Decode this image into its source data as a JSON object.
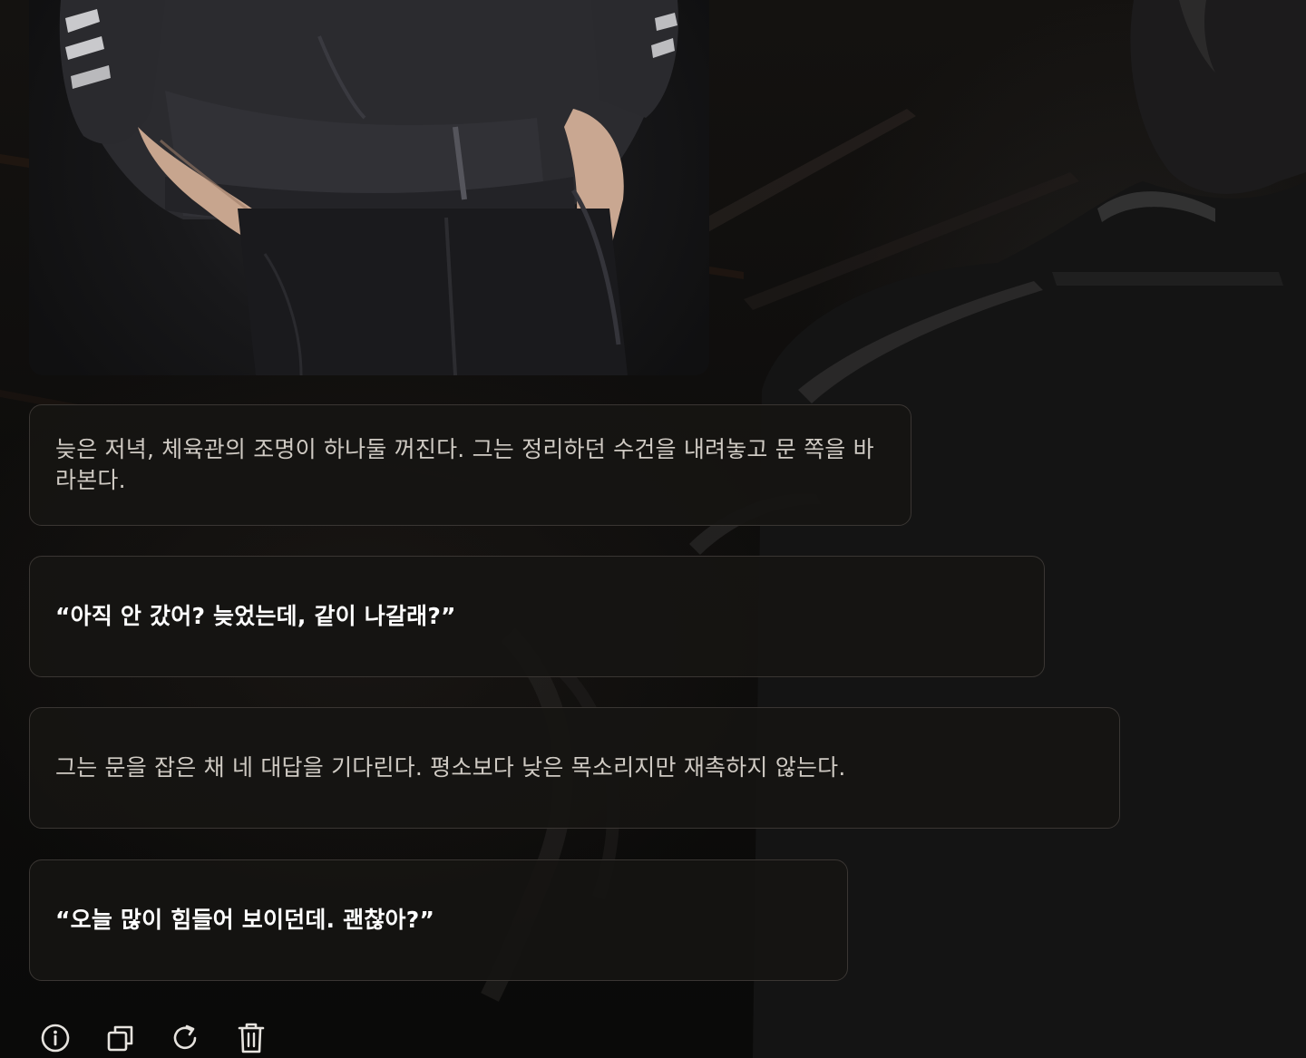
{
  "messages": [
    {
      "type": "narration",
      "text": "늦은 저녁, 체육관의 조명이 하나둘 꺼진다. 그는 정리하던 수건을 내려놓고 문 쪽을 바라본다."
    },
    {
      "type": "dialogue",
      "text": "“아직 안 갔어? 늦었는데, 같이 나갈래?”"
    },
    {
      "type": "narration",
      "text": "그는 문을 잡은 채 네 대답을 기다린다. 평소보다 낮은 목소리지만 재촉하지 않는다."
    },
    {
      "type": "dialogue",
      "text": "“오늘 많이 힘들어 보이던데. 괜찮아?”"
    }
  ],
  "toolbar": {
    "icons": [
      "info-icon",
      "copy-icon",
      "regenerate-icon",
      "trash-icon"
    ]
  },
  "colors": {
    "bubble_bg": "#161412",
    "bubble_border": "#3a3633",
    "dialogue_text": "#ffffff",
    "narration_text": "#cfcac3",
    "icon": "#e6e3de"
  }
}
